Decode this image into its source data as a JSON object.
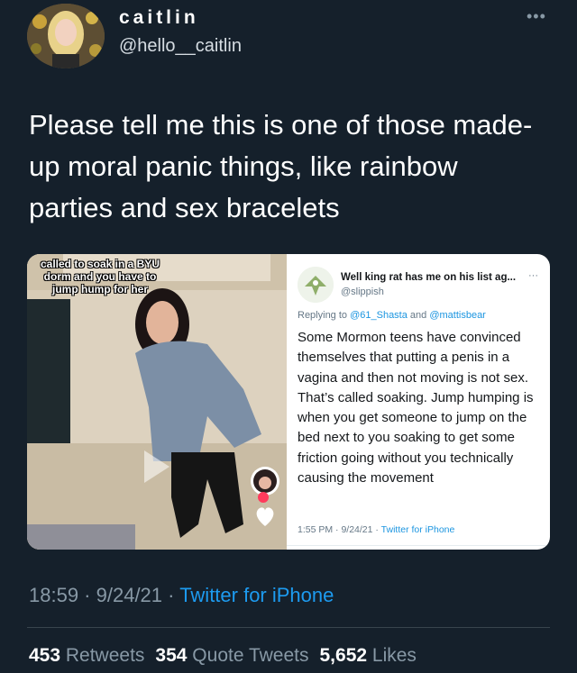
{
  "author": {
    "display_name": "caitlin",
    "handle": "@hello__caitlin",
    "more_label": "•••"
  },
  "tweet": {
    "text": "Please tell me this is one of those made-up moral panic things, like rainbow parties and sex bracelets",
    "time": "18:59",
    "sep": " · ",
    "date": "9/24/21",
    "source": "Twitter for iPhone"
  },
  "video": {
    "caption": "called to soak in a BYU dorm and you have to jump hump for her"
  },
  "quoted_reply": {
    "name": "Well king rat has me on his list ag...",
    "handle": "@slippish",
    "more_label": "···",
    "replying_prefix": "Replying to ",
    "mention_1": "@61_Shasta",
    "replying_and": " and ",
    "mention_2": "@mattisbear",
    "body": "Some Mormon teens have convinced themselves that putting a penis in a vagina and then not moving is not sex. That’s called soaking. Jump humping is when you get someone to jump on the bed next to you soaking to get some friction going without you technically causing the movement",
    "time": "1:55 PM",
    "date": "9/24/21",
    "sep": " · ",
    "source": "Twitter for iPhone"
  },
  "stats": {
    "retweets_count": "453",
    "retweets_label": " Retweets",
    "quotes_count": "354",
    "quotes_label": " Quote Tweets",
    "likes_count": "5,652",
    "likes_label": " Likes"
  },
  "colors": {
    "background": "#15202b",
    "link": "#1d9bf0",
    "muted": "#8899a6"
  }
}
